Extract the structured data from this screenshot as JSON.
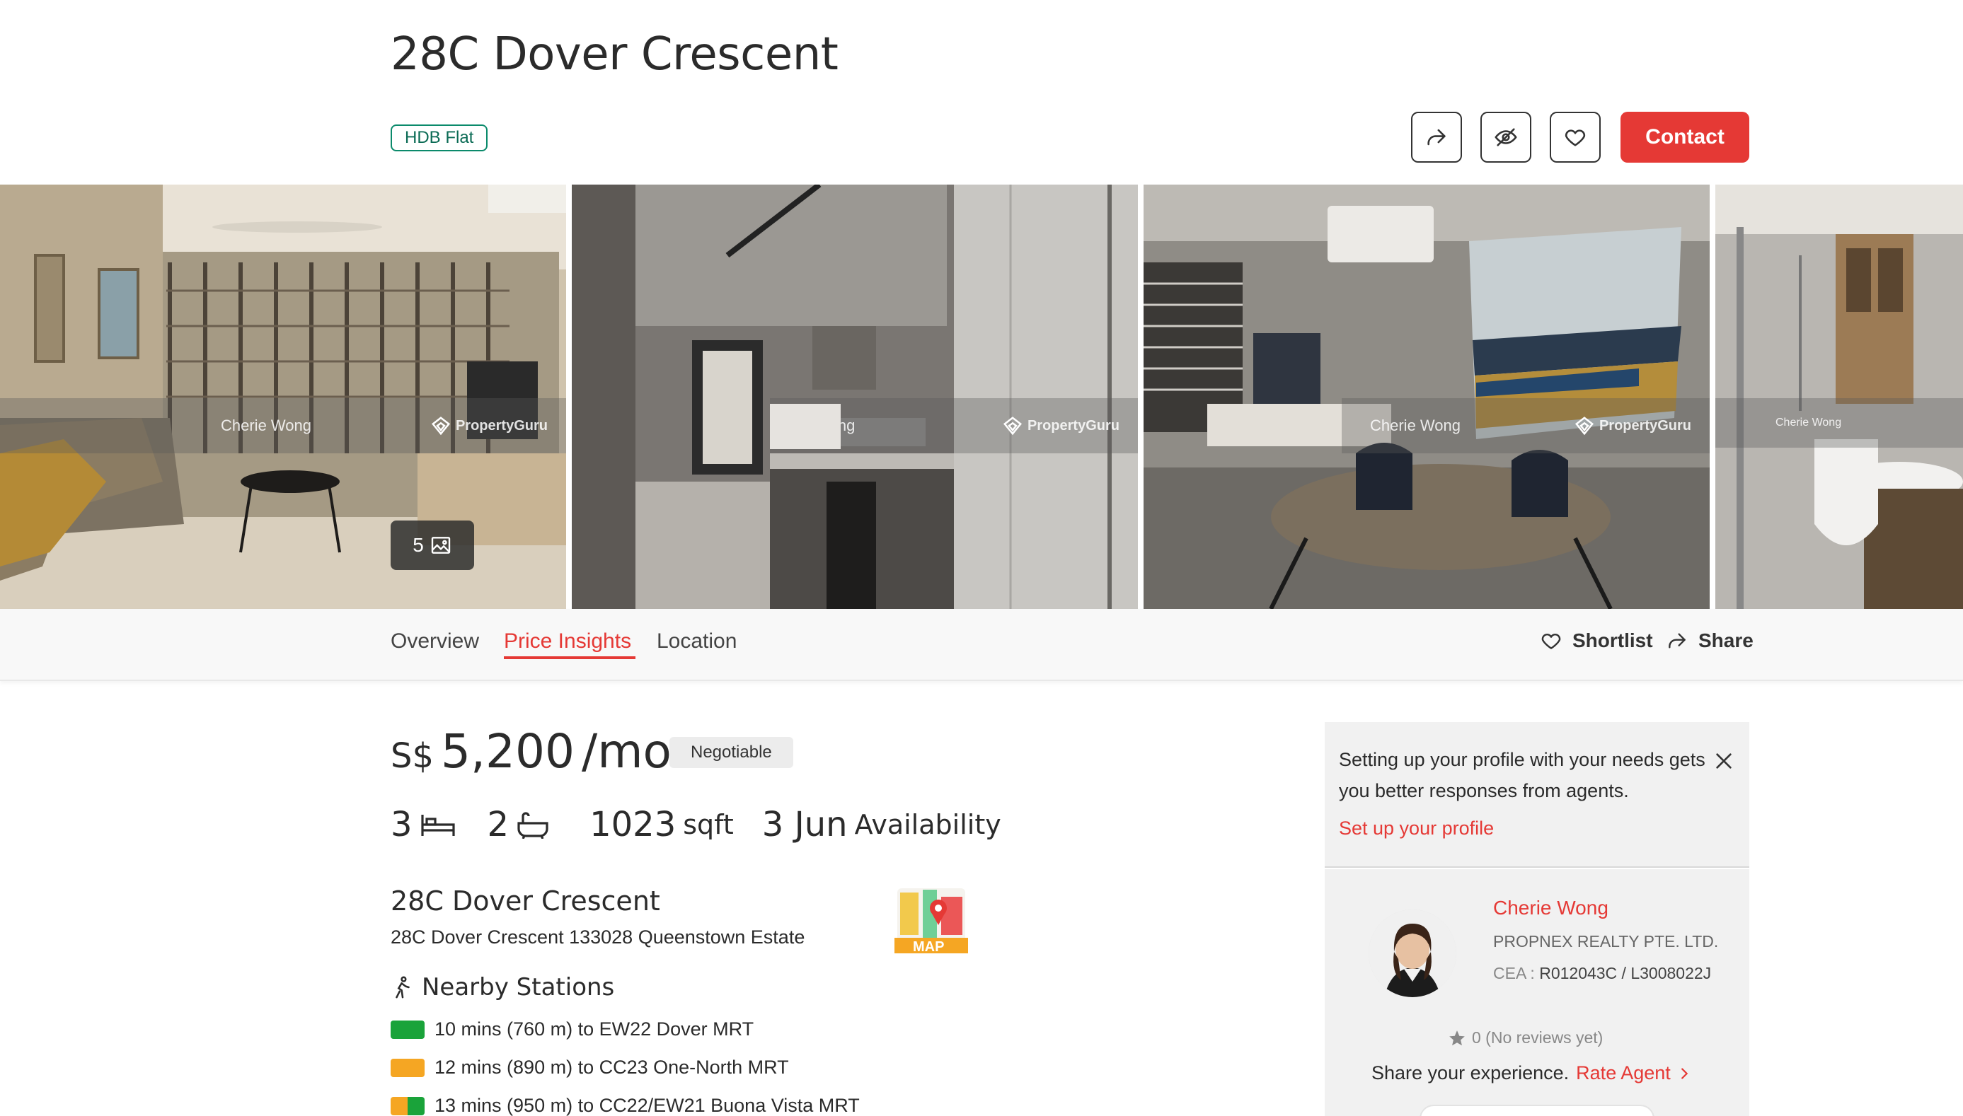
{
  "header": {
    "title": "28C Dover Crescent",
    "property_type": "HDB Flat",
    "contact_label": "Contact",
    "icons": [
      "share-icon",
      "hide-icon",
      "heart-icon"
    ]
  },
  "gallery": {
    "photo_count": "5",
    "watermark_agent": "Cherie Wong",
    "watermark_brand": "PropertyGuru",
    "watermark_agent_partial": "ie Wong"
  },
  "tabs": {
    "items": [
      "Overview",
      "Price Insights",
      "Location"
    ],
    "active": "Price Insights",
    "shortlist_label": "Shortlist",
    "share_label": "Share"
  },
  "listing": {
    "currency": "S$",
    "price": "5,200",
    "period": "/mo",
    "negotiable": "Negotiable",
    "bedrooms": "3",
    "bathrooms": "2",
    "size": "1023",
    "size_unit": "sqft",
    "availability_date": "3 Jun",
    "availability_label": "Availability",
    "address_title": "28C Dover Crescent",
    "address_full": "28C Dover Crescent 133028 Queenstown Estate",
    "map_label": "MAP"
  },
  "nearby": {
    "title": "Nearby Stations",
    "stations": [
      {
        "text": "10 mins (760 m) to EW22 Dover MRT",
        "colors": [
          "#1aa33a"
        ]
      },
      {
        "text": "12 mins (890 m) to CC23 One-North MRT",
        "colors": [
          "#f5a623"
        ]
      },
      {
        "text": "13 mins (950 m) to CC22/EW21 Buona Vista MRT",
        "colors": [
          "#f5a623",
          "#1aa33a"
        ]
      }
    ]
  },
  "profile_prompt": {
    "text": "Setting up your profile with your needs gets you better responses from agents.",
    "link": "Set up your profile"
  },
  "agent": {
    "name": "Cherie Wong",
    "company": "PROPNEX REALTY PTE. LTD.",
    "cea_label": "CEA :",
    "cea_value": "R012043C / L3008022J",
    "reviews": "0 (No reviews yet)",
    "share_experience": "Share your experience.",
    "rate_label": "Rate Agent"
  },
  "colors": {
    "accent": "#e53935",
    "tag_green": "#0b8a6b"
  }
}
